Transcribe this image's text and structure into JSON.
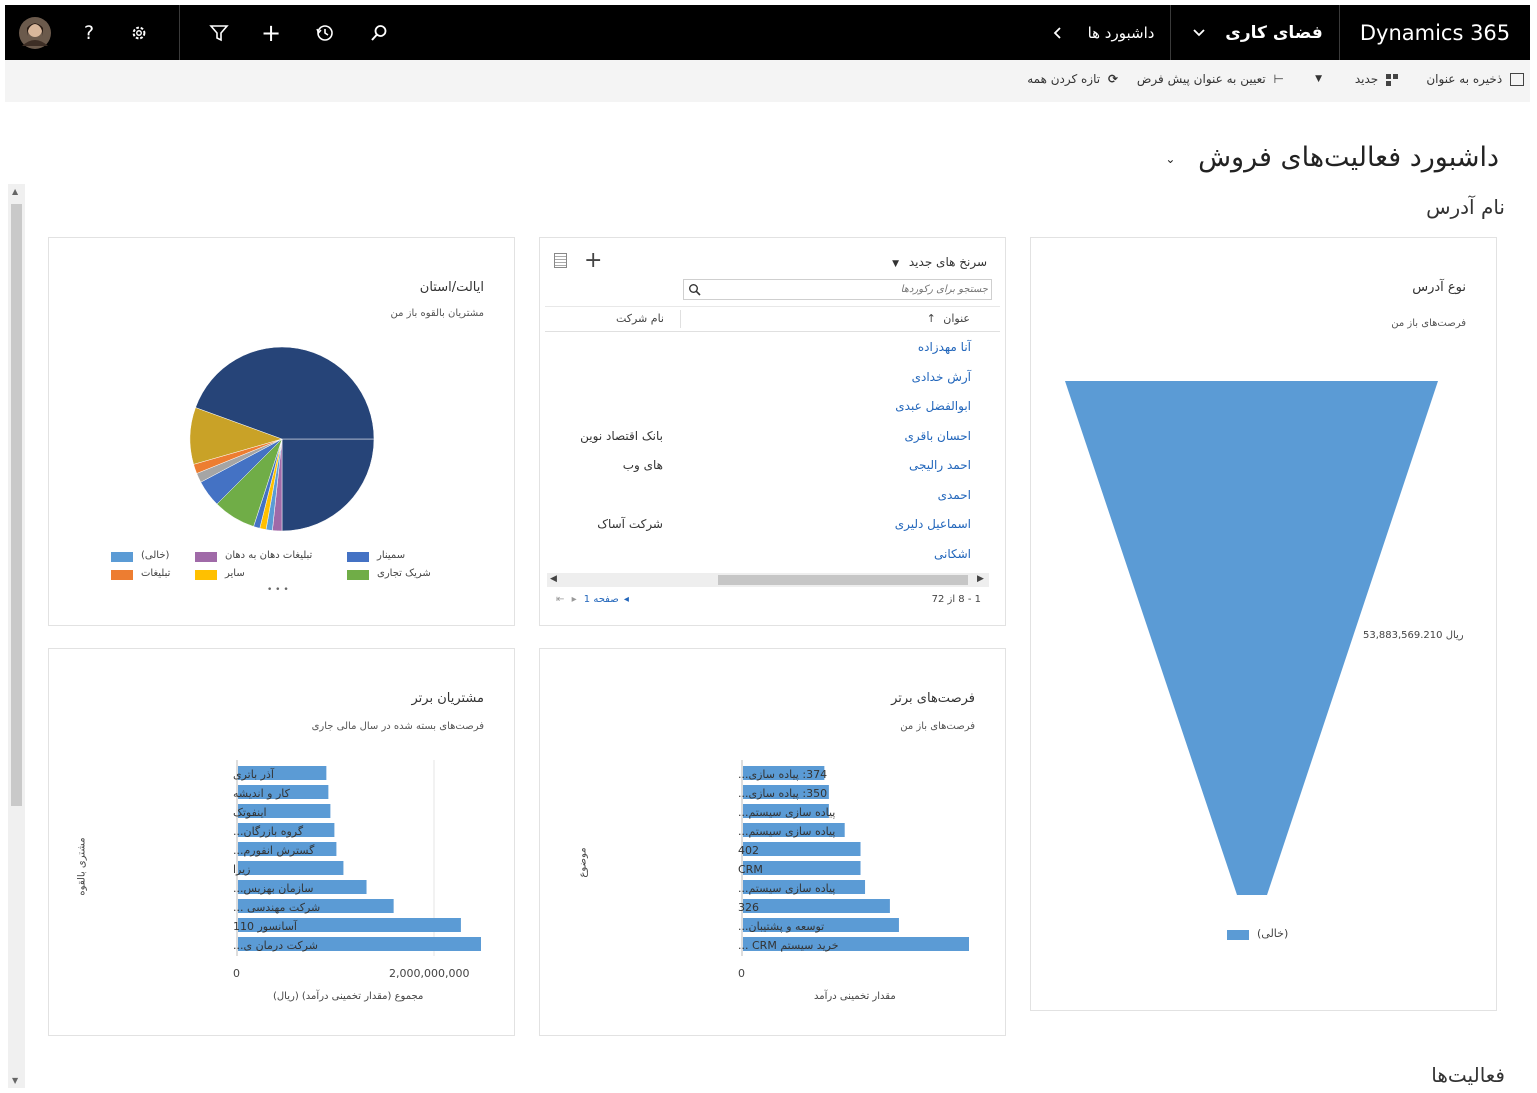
{
  "nav": {
    "brand": "Dynamics 365",
    "workspace": "فضای کاری",
    "dashboards": "داشبورد ها"
  },
  "commands": {
    "save_as": "ذخیره به عنوان",
    "new": "جدید",
    "set_default": "تعیین به عنوان پیش فرض",
    "refresh_all": "تازه کردن همه"
  },
  "page": {
    "title": "داشبورد فعالیت‌های فروش",
    "section_address": "نام آدرس",
    "section_activities": "فعالیت‌ها"
  },
  "funnel": {
    "title": "نوع آدرس",
    "subtitle": "فرصت‌های باز من",
    "value_label": "ریال 53,883,569.210",
    "legend": "(خالی)",
    "color": "#5b9bd5"
  },
  "leads": {
    "view_name": "سرنخ های جدید",
    "search_placeholder": "جستجو برای رکوردها",
    "col_title": "عنوان",
    "col_company": "نام شرکت",
    "rows": [
      {
        "title": "آنا مهدزاده",
        "company": ""
      },
      {
        "title": "آرش خدادی",
        "company": ""
      },
      {
        "title": "ابوالفضل عبدی",
        "company": ""
      },
      {
        "title": "احسان باقری",
        "company": "بانک اقتصاد نوین"
      },
      {
        "title": "احمد رالیجی",
        "company": "های وب"
      },
      {
        "title": "احمدی",
        "company": ""
      },
      {
        "title": "اسماعیل دلیری",
        "company": "شرکت آساک"
      },
      {
        "title": "اشکانی",
        "company": ""
      }
    ],
    "page_label": "صفحه 1",
    "range_label": "1 - 8 از 72"
  },
  "pie": {
    "title": "ایالت/استان",
    "subtitle": "مشتریان بالقوه باز من",
    "legend": [
      {
        "label": "سمینار",
        "color": "#4472c4"
      },
      {
        "label": "تبلیغات دهان به دهان",
        "color": "#a06aa8"
      },
      {
        "label": "(خالی)",
        "color": "#5b9bd5"
      },
      {
        "label": "شریک تجاری",
        "color": "#70ad47"
      },
      {
        "label": "سایر",
        "color": "#ffc000"
      },
      {
        "label": "تبلیغات",
        "color": "#ed7d31"
      }
    ],
    "more": "• • •"
  },
  "top_opps": {
    "title": "فرصت‌های برتر",
    "subtitle": "فرصت‌های باز من",
    "ylabel": "موضوع",
    "xlabel": "مقدار تخمینی درآمد",
    "tick0": "0",
    "categories": [
      "374: پیاده سازی...",
      "350: پیاده سازی...",
      "پیاده سازی سیستم...",
      "پیاده سازی سیستم...",
      "402",
      "CRM",
      "پیاده سازی سیستم...",
      "326",
      "توسعه و پشتیبان...",
      "خرید سیستم CRM ..."
    ],
    "values": [
      0.36,
      0.38,
      0.38,
      0.45,
      0.52,
      0.52,
      0.54,
      0.65,
      0.69,
      1.0
    ]
  },
  "top_customers": {
    "title": "مشتریان برتر",
    "subtitle": "فرصت‌های بسته شده در سال مالی جاری",
    "ylabel": "مشتری بالقوه",
    "xlabel": "مجموع (مقدار تخمینی درآمد) (ریال)",
    "tick0": "0",
    "tick1": "2,000,000,000",
    "categories": [
      "آذر باتری",
      "کار و اندیشه",
      "اینفوتک",
      "گروه بازرگان...",
      "گسترش انفورم...",
      "زیرا",
      "سازمان بهزیس...",
      "شرکت مهندسی ...",
      "آسانسور 110",
      "شرکت درمان ی..."
    ],
    "values": [
      880000000,
      900000000,
      920000000,
      960000000,
      980000000,
      1050000000,
      1280000000,
      1550000000,
      2220000000,
      2420000000
    ]
  }
}
